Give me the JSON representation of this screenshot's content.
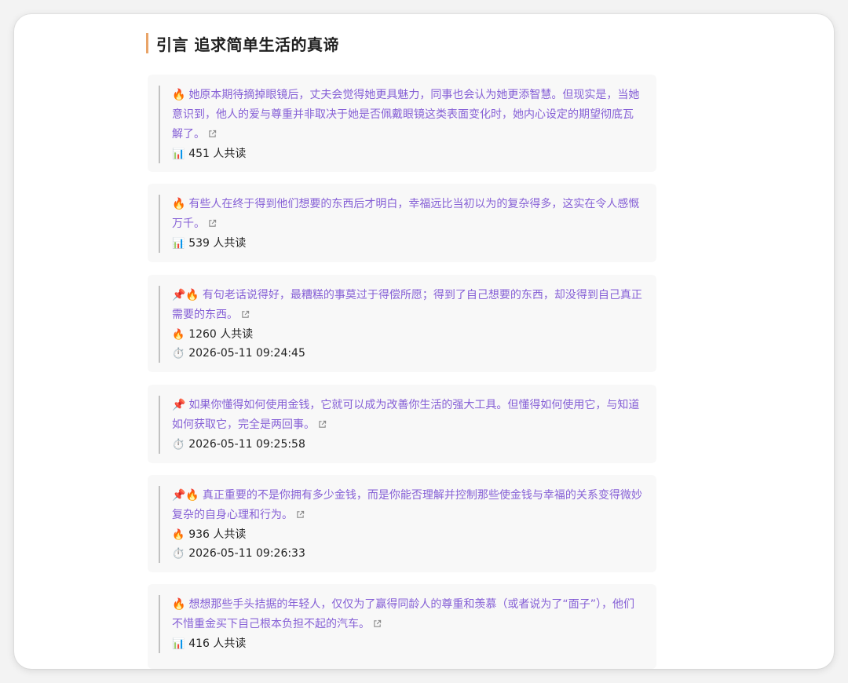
{
  "section": {
    "title": "引言 追求简单生活的真谛"
  },
  "cards": [
    {
      "prefix": "🔥",
      "text": "她原本期待摘掉眼镜后，丈夫会觉得她更具魅力，同事也会认为她更添智慧。但现实是，当她意识到，他人的爱与尊重并非取决于她是否佩戴眼镜这类表面变化时，她内心设定的期望彻底瓦解了。",
      "count_icon": "📊",
      "count": "451 人共读"
    },
    {
      "prefix": "🔥",
      "text": "有些人在终于得到他们想要的东西后才明白，幸福远比当初以为的复杂得多，这实在令人感慨万千。",
      "count_icon": "📊",
      "count": "539 人共读"
    },
    {
      "prefix": "📌🔥",
      "text": "有句老话说得好，最糟糕的事莫过于得偿所愿；得到了自己想要的东西，却没得到自己真正需要的东西。",
      "count_icon": "🔥",
      "count": "1260 人共读",
      "time": "2026-05-11 09:24:45"
    },
    {
      "prefix": "📌",
      "text": "如果你懂得如何使用金钱，它就可以成为改善你生活的强大工具。但懂得如何使用它，与知道如何获取它，完全是两回事。",
      "time": "2026-05-11 09:25:58"
    },
    {
      "prefix": "📌🔥",
      "text": "真正重要的不是你拥有多少金钱，而是你能否理解并控制那些使金钱与幸福的关系变得微妙复杂的自身心理和行为。",
      "count_icon": "🔥",
      "count": "936 人共读",
      "time": "2026-05-11 09:26:33"
    },
    {
      "prefix": "🔥",
      "text": "想想那些手头拮据的年轻人，仅仅为了赢得同龄人的尊重和羡慕（或者说为了“面子”），他们不惜重金买下自己根本负担不起的汽车。",
      "count_icon": "📊",
      "count": "416 人共读"
    }
  ],
  "time_icon": "⏱️",
  "colors": {
    "accent": "#e9a468",
    "quote_text": "#8660d6",
    "card_bg": "#f8f8f8"
  }
}
